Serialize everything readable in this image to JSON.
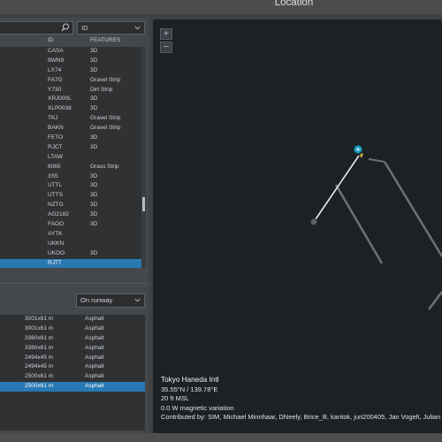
{
  "header": {
    "title": "Location"
  },
  "search": {
    "placeholder": ""
  },
  "id_filter": {
    "selected": "ID"
  },
  "table": {
    "columns": [
      "ID",
      "FEATURES"
    ],
    "rows": [
      {
        "id": "CASA",
        "features": "3D"
      },
      {
        "id": "9WN9",
        "features": "3D"
      },
      {
        "id": "LX74",
        "features": "3D"
      },
      {
        "id": "FA7G",
        "features": "Gravel Strip"
      },
      {
        "id": "Y730",
        "features": "Dirt Strip"
      },
      {
        "id": "XRJ000L",
        "features": "3D"
      },
      {
        "id": "XLP0038",
        "features": "3D"
      },
      {
        "id": "TKJ",
        "features": "Gravel Strip"
      },
      {
        "id": "BAKN",
        "features": "Gravel Strip"
      },
      {
        "id": "FETO",
        "features": "3D"
      },
      {
        "id": "RJCT",
        "features": "3D"
      },
      {
        "id": "LTAW",
        "features": ""
      },
      {
        "id": "6065",
        "features": "Grass Strip"
      },
      {
        "id": "3S5",
        "features": "3D"
      },
      {
        "id": "UTTL",
        "features": "3D"
      },
      {
        "id": "UTTS",
        "features": "3D"
      },
      {
        "id": "NZTG",
        "features": "3D"
      },
      {
        "id": "AG2182",
        "features": "3D"
      },
      {
        "id": "FAOO",
        "features": "3D"
      },
      {
        "id": "AYTK",
        "features": ""
      },
      {
        "id": "UKKN",
        "features": ""
      },
      {
        "id": "UKOO",
        "features": "3D"
      },
      {
        "id": "RJTT",
        "features": ""
      }
    ]
  },
  "runway_filter": {
    "selected": "On runway"
  },
  "runways": [
    {
      "dim": "3001x61 m",
      "surface": "Asphalt"
    },
    {
      "dim": "3001x61 m",
      "surface": "Asphalt"
    },
    {
      "dim": "3360x61 m",
      "surface": "Asphalt"
    },
    {
      "dim": "3360x61 m",
      "surface": "Asphalt"
    },
    {
      "dim": "2494x45 m",
      "surface": "Asphalt"
    },
    {
      "dim": "2494x45 m",
      "surface": "Asphalt"
    },
    {
      "dim": "2500x61 m",
      "surface": "Asphalt"
    },
    {
      "dim": "2500x61 m",
      "surface": "Asphalt"
    }
  ],
  "airport": {
    "name": "Tokyo Haneda Intl",
    "coords": "35.55°N / 139.78°E",
    "elevation": "20 ft MSL",
    "variation": "0.0 W magnetic variation",
    "contributors": "Contributed by: SIM, Michael Minnhaar, DNeely, Brice_B, kantok, juri200405, Jan Vogelt, Julian"
  },
  "map": {
    "zoom_in": "+",
    "zoom_out": "−",
    "accent_color": "#1fa3c4",
    "runway_color": "#6b7178"
  },
  "colors": {
    "selection": "#2878b4"
  }
}
